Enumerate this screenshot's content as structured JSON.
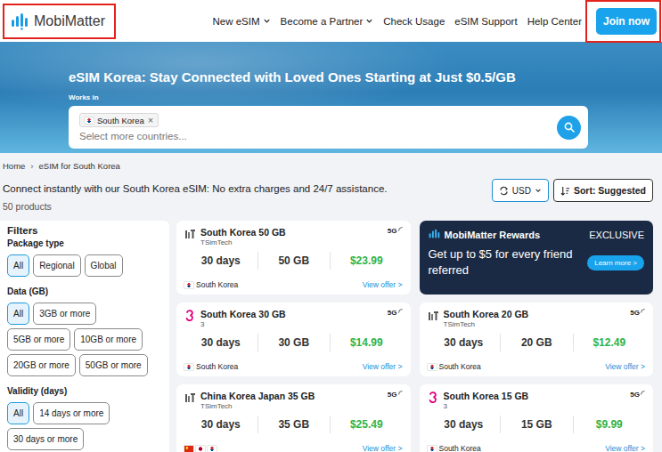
{
  "header": {
    "logo": {
      "text": "MobiMatter",
      "highlighted": true
    },
    "nav": [
      {
        "label": "New eSIM",
        "dropdown": true
      },
      {
        "label": "Become a Partner",
        "dropdown": true
      },
      {
        "label": "Check Usage",
        "dropdown": false
      },
      {
        "label": "eSIM Support",
        "dropdown": false
      },
      {
        "label": "Help Center",
        "dropdown": false
      }
    ],
    "join": {
      "label": "Join now",
      "highlighted": true
    }
  },
  "hero": {
    "title": "eSIM Korea: Stay Connected with Loved Ones Starting at Just $0.5/GB",
    "works_in": "Works in",
    "chips": [
      {
        "label": "South Korea",
        "flag": "kr",
        "remove": "×"
      }
    ],
    "placeholder": "Select more countries..."
  },
  "breadcrumb": {
    "items": [
      "Home",
      "eSIM for South Korea"
    ],
    "separator": "›"
  },
  "intro": "Connect instantly with our South Korea eSIM: No extra charges and 24/7 assistance.",
  "count": "50 products",
  "currency": "USD",
  "sort": "Sort: Suggested",
  "filters": {
    "title": "Filters",
    "groups": [
      {
        "title": "Package type",
        "options": [
          {
            "label": "All",
            "selected": true
          },
          {
            "label": "Regional",
            "selected": false
          },
          {
            "label": "Global",
            "selected": false
          }
        ]
      },
      {
        "title": "Data (GB)",
        "options": [
          {
            "label": "All",
            "selected": true
          },
          {
            "label": "3GB or more",
            "selected": false
          },
          {
            "label": "5GB or more",
            "selected": false
          },
          {
            "label": "10GB or more",
            "selected": false
          },
          {
            "label": "20GB or more",
            "selected": false
          },
          {
            "label": "50GB or more",
            "selected": false
          }
        ]
      },
      {
        "title": "Validity (days)",
        "options": [
          {
            "label": "All",
            "selected": true
          },
          {
            "label": "14 days or more",
            "selected": false
          },
          {
            "label": "30 days or more",
            "selected": false
          }
        ]
      }
    ]
  },
  "cards": [
    {
      "kind": "offer",
      "title": "South Korea 50 GB",
      "provider": "TSimTech",
      "provider_logo": "tsim",
      "network": "5G",
      "days": "30 days",
      "data": "50 GB",
      "price": "$23.99",
      "flags": [
        "kr"
      ],
      "countries": "South Korea",
      "link": "View offer >"
    },
    {
      "kind": "promo",
      "title": "MobiMatter Rewards",
      "badge": "EXCLUSIVE",
      "text": "Get up to $5 for every friend referred",
      "link": "Learn more >"
    },
    {
      "kind": "offer",
      "title": "South Korea 30 GB",
      "provider": "3",
      "provider_logo": "three",
      "network": "5G",
      "days": "30 days",
      "data": "30 GB",
      "price": "$14.99",
      "flags": [
        "kr"
      ],
      "countries": "South Korea",
      "link": "View offer >"
    },
    {
      "kind": "offer",
      "title": "South Korea 20 GB",
      "provider": "TSimTech",
      "provider_logo": "tsim",
      "network": "5G",
      "days": "30 days",
      "data": "20 GB",
      "price": "$12.49",
      "flags": [
        "kr"
      ],
      "countries": "South Korea",
      "link": "View offer >"
    },
    {
      "kind": "offer",
      "title": "China Korea Japan 35 GB",
      "provider": "TSimTech",
      "provider_logo": "tsim",
      "network": "5G",
      "days": "30 days",
      "data": "35 GB",
      "price": "$25.49",
      "flags": [
        "cn",
        "jp",
        "kr"
      ],
      "link": "View offer >"
    },
    {
      "kind": "offer",
      "title": "South Korea 15 GB",
      "provider": "3",
      "provider_logo": "three",
      "network": "5G",
      "days": "30 days",
      "data": "15 GB",
      "price": "$9.99",
      "flags": [
        "kr"
      ],
      "countries": "South Korea",
      "link": "View offer >"
    }
  ]
}
